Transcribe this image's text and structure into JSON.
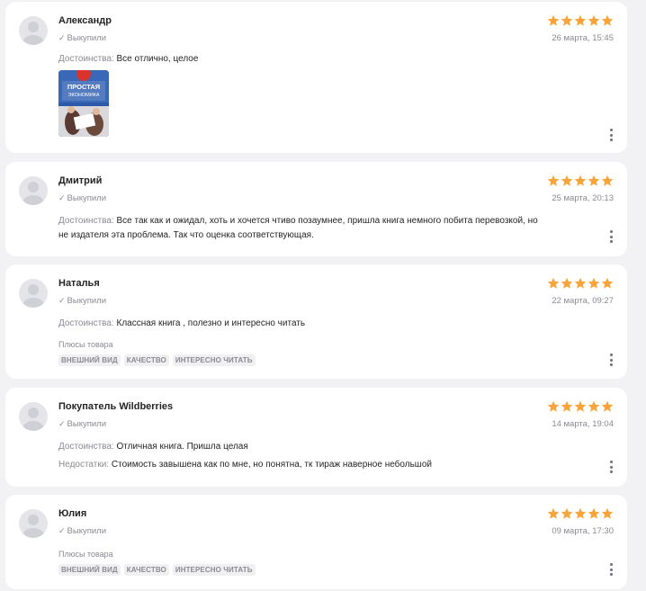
{
  "colors": {
    "star": "#f9a43a",
    "muted": "#8a8a93",
    "card": "#ffffff",
    "page": "#f2f2f5"
  },
  "reviews": [
    {
      "name": "Александр",
      "bought": "Выкупили",
      "date": "26 марта, 15:45",
      "rating": 5,
      "pros_label": "Достоинства:",
      "pros_text": "Все отлично, целое",
      "photo": {
        "title_line1": "ПРОСТАЯ",
        "title_line2": "ЭКОНОМИКА"
      }
    },
    {
      "name": "Дмитрий",
      "bought": "Выкупили",
      "date": "25 марта, 20:13",
      "rating": 5,
      "pros_label": "Достоинства:",
      "pros_text_line1": "Все так как и ожидал, хоть и хочется чтиво позаумнее, пришла книга немного побита перевозкой, но",
      "pros_text_line2": "не издателя эта проблема. Так что оценка соответствующая."
    },
    {
      "name": "Наталья",
      "bought": "Выкупили",
      "date": "22 марта, 09:27",
      "rating": 5,
      "pros_label": "Достоинства:",
      "pros_text": "Классная книга , полезно и интересно читать",
      "plus_title": "Плюсы товара",
      "tags": [
        "ВНЕШНИЙ ВИД",
        "КАЧЕСТВО",
        "ИНТЕРЕСНО ЧИТАТЬ"
      ]
    },
    {
      "name": "Покупатель Wildberries",
      "bought": "Выкупили",
      "date": "14 марта, 19:04",
      "rating": 5,
      "pros_label": "Достоинства:",
      "pros_text": "Отличная книга. Пришла целая",
      "cons_label": "Недостатки:",
      "cons_text": "Стоимость завышена как по мне, но понятна, тк тираж наверное небольшой"
    },
    {
      "name": "Юлия",
      "bought": "Выкупили",
      "date": "09 марта, 17:30",
      "rating": 5,
      "plus_title": "Плюсы товара",
      "tags": [
        "ВНЕШНИЙ ВИД",
        "КАЧЕСТВО",
        "ИНТЕРЕСНО ЧИТАТЬ"
      ]
    }
  ]
}
